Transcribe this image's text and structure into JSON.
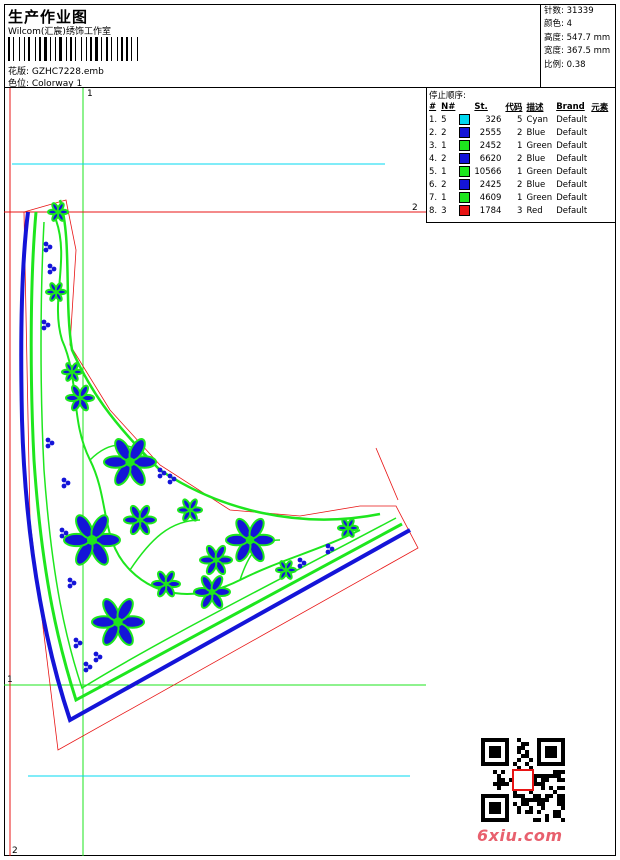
{
  "header": {
    "title": "生产作业图",
    "subtitle": "Wilcom(汇宸)绣饰工作室",
    "design_label": "花版: GZHC7228.emb",
    "colorway_label": "色位: Colorway 1"
  },
  "stats": [
    {
      "label": "针数:",
      "value": "31339"
    },
    {
      "label": "颜色:",
      "value": "4"
    },
    {
      "label": "高度:",
      "value": "547.7 mm"
    },
    {
      "label": "宽度:",
      "value": "367.5 mm"
    },
    {
      "label": "比例:",
      "value": "0.38"
    }
  ],
  "legend": {
    "caption": "停止顺序:",
    "headers": [
      "#",
      "N#",
      "St.",
      "代码",
      "描述",
      "Brand",
      "元素"
    ],
    "rows": [
      {
        "idx": "1.",
        "n": "5",
        "color": "#00d8f0",
        "st": "326",
        "code": "5",
        "desc": "Cyan",
        "brand": "Default"
      },
      {
        "idx": "2.",
        "n": "2",
        "color": "#1414d8",
        "st": "2555",
        "code": "2",
        "desc": "Blue",
        "brand": "Default"
      },
      {
        "idx": "3.",
        "n": "1",
        "color": "#1ee61e",
        "st": "2452",
        "code": "1",
        "desc": "Green",
        "brand": "Default"
      },
      {
        "idx": "4.",
        "n": "2",
        "color": "#1414d8",
        "st": "6620",
        "code": "2",
        "desc": "Blue",
        "brand": "Default"
      },
      {
        "idx": "5.",
        "n": "1",
        "color": "#1ee61e",
        "st": "10566",
        "code": "1",
        "desc": "Green",
        "brand": "Default"
      },
      {
        "idx": "6.",
        "n": "2",
        "color": "#1414d8",
        "st": "2425",
        "code": "2",
        "desc": "Blue",
        "brand": "Default"
      },
      {
        "idx": "7.",
        "n": "1",
        "color": "#1ee61e",
        "st": "4609",
        "code": "1",
        "desc": "Green",
        "brand": "Default"
      },
      {
        "idx": "8.",
        "n": "3",
        "color": "#e81414",
        "st": "1784",
        "code": "3",
        "desc": "Red",
        "brand": "Default"
      }
    ]
  },
  "axis_labels": {
    "top_v": "1",
    "right_h": "2",
    "left_h": "1",
    "bottom_left": "2"
  },
  "watermark": {
    "site": "6xiu.com"
  },
  "colors": {
    "green": "#1ee61e",
    "blue": "#1414d8",
    "cyan": "#00d8f0",
    "red": "#e81414"
  }
}
